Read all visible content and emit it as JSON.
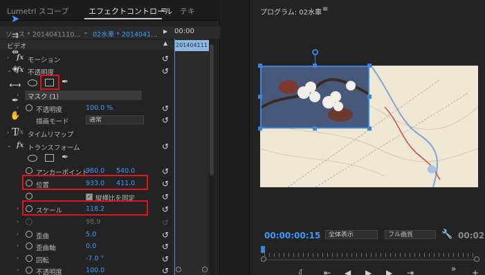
{
  "tabs": {
    "lumetri": "Lumetri スコープ",
    "effect_controls": "エフェクトコントロール",
    "menu": "≡",
    "text": "テキ"
  },
  "source_bar": {
    "source": "ソース * 2014041110...",
    "sequence": "02水車 * 2014041...",
    "time": "00:00"
  },
  "timeline_clip": "201404111",
  "props": {
    "video": "ビデオ",
    "motion": "モーション",
    "opacity": "不透明度",
    "mask": "マスク (1)",
    "opacity_value_label": "不透明度",
    "opacity_value": "100.0 %",
    "blend_mode_label": "描画モード",
    "blend_mode": "通常",
    "time_remap": "タイムリマップ",
    "transform": "トランスフォーム",
    "anchor_label": "アンカーポイント",
    "anchor_x": "960.0",
    "anchor_y": "540.0",
    "position_label": "位置",
    "position_x": "933.0",
    "position_y": "411.0",
    "uniform_scale_label": "縦横比を固定",
    "scale_label": "スケール",
    "scale_value": "118.2",
    "scale_width_value": "98.9",
    "skew_label": "歪曲",
    "skew_value": "5.0",
    "skew_axis_label": "歪曲軸",
    "skew_axis_value": "0.0",
    "rotation_label": "回転",
    "rotation_value": "-7.0 °",
    "opacity2_label": "不透明度",
    "opacity2_value": "100.0"
  },
  "program": {
    "title": "プログラム: 02水車",
    "menu": "≡",
    "timecode": "00:00:00:15",
    "zoom": "全体表示",
    "quality": "フル画質",
    "timecode_end": "00:02"
  },
  "colors": {
    "accent": "#3f9bff",
    "highlight_box": "#e0161c",
    "selection": "#3b86d9"
  }
}
